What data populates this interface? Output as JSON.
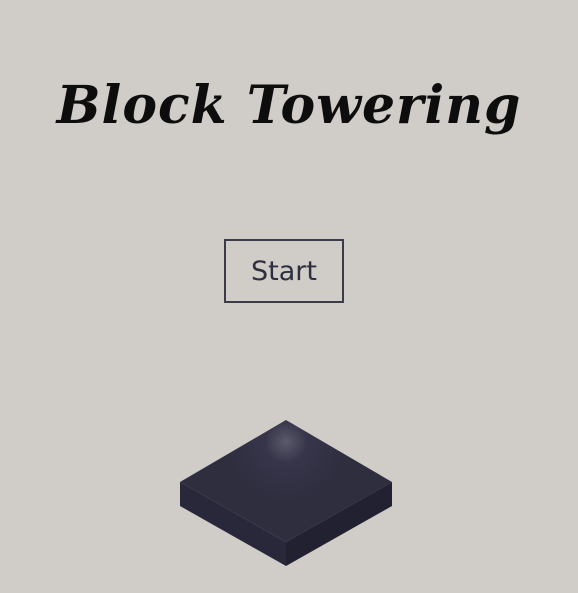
{
  "game": {
    "title": "Block Towering"
  },
  "menu": {
    "start_label": "Start"
  },
  "colors": {
    "background": "#d0ccc8",
    "title_text": "#0d0d0d",
    "button_border": "#3b3b4a",
    "block_top": "#2f2e3f",
    "block_left": "#29283a",
    "block_right": "#222131"
  }
}
